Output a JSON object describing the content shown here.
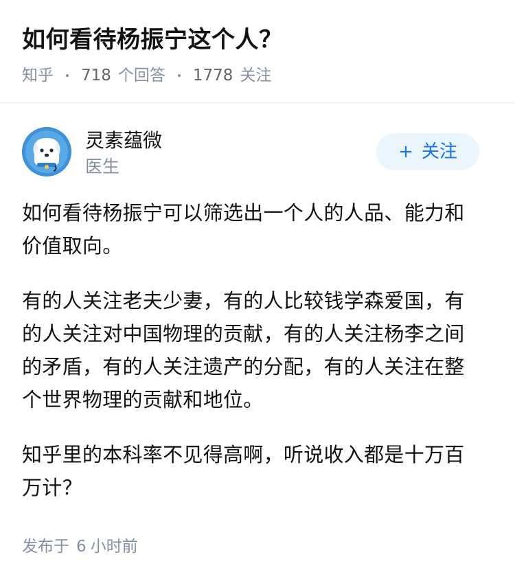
{
  "question": {
    "title": "如何看待杨振宁这个人？",
    "source": "知乎",
    "answers_count": "718",
    "answers_label": "个回答",
    "follow_count": "1778",
    "follow_label": "关注"
  },
  "author": {
    "name": "灵素蕴微",
    "description": "医生",
    "avatar_icon": "cartoon-dog-avatar",
    "follow_button_label": "关注",
    "follow_button_icon": "plus-icon"
  },
  "answer": {
    "paragraphs": [
      "如何看待杨振宁可以筛选出一个人的人品、能力和价值取向。",
      "有的人关注老夫少妻，有的人比较钱学森爱国，有的人关注对中国物理的贡献，有的人关注杨李之间的矛盾，有的人关注遗产的分配，有的人关注在整个世界物理的贡献和地位。",
      "知乎里的本科率不见得高啊，听说收入都是十万百万计？"
    ],
    "time_prefix": "发布于",
    "time_value": "6",
    "time_unit": "小时前"
  },
  "colors": {
    "accent": "#1772f6",
    "follow_bg": "#ebf5fd",
    "meta_gray": "#8590a6",
    "text": "#121212"
  }
}
